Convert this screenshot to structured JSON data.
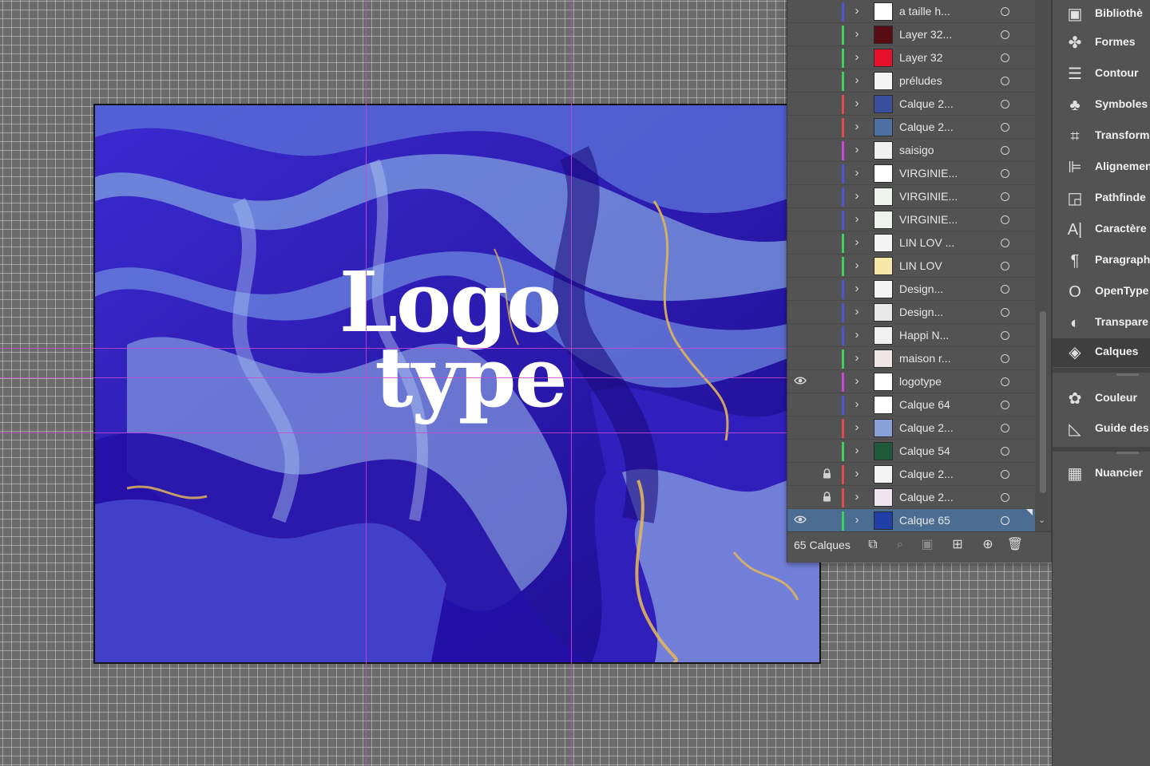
{
  "artboard": {
    "logotype_line1": "Logo",
    "logotype_line2": "type"
  },
  "layers_panel": {
    "layers": [
      {
        "name": "a taille h...",
        "color": "#4b55d6",
        "visible": false,
        "locked": false,
        "thumb": "#ffffff"
      },
      {
        "name": "Layer 32...",
        "color": "#3fd05b",
        "visible": false,
        "locked": false,
        "thumb": "#5a0c14"
      },
      {
        "name": "Layer 32",
        "color": "#3fd05b",
        "visible": false,
        "locked": false,
        "thumb": "#e8102b"
      },
      {
        "name": "préludes",
        "color": "#3fd05b",
        "visible": false,
        "locked": false,
        "thumb": "#f4f4f4"
      },
      {
        "name": "Calque 2...",
        "color": "#e34a4a",
        "visible": false,
        "locked": false,
        "thumb": "#3a4f9c"
      },
      {
        "name": "Calque 2...",
        "color": "#e34a4a",
        "visible": false,
        "locked": false,
        "thumb": "#4e6fa2"
      },
      {
        "name": "saisigo",
        "color": "#c64ad3",
        "visible": false,
        "locked": false,
        "thumb": "#f0f0f0"
      },
      {
        "name": "VIRGINIE...",
        "color": "#4b55d6",
        "visible": false,
        "locked": false,
        "thumb": "#ffffff"
      },
      {
        "name": "VIRGINIE...",
        "color": "#4b55d6",
        "visible": false,
        "locked": false,
        "thumb": "#eef3ee"
      },
      {
        "name": "VIRGINIE...",
        "color": "#4b55d6",
        "visible": false,
        "locked": false,
        "thumb": "#eef3ee"
      },
      {
        "name": "LIN LOV ...",
        "color": "#3fd05b",
        "visible": false,
        "locked": false,
        "thumb": "#f4f4f4"
      },
      {
        "name": "LIN LOV",
        "color": "#3fd05b",
        "visible": false,
        "locked": false,
        "thumb": "#f7e7a8"
      },
      {
        "name": "Design...",
        "color": "#4b55d6",
        "visible": false,
        "locked": false,
        "thumb": "#f4f4f4"
      },
      {
        "name": "Design...",
        "color": "#4b55d6",
        "visible": false,
        "locked": false,
        "thumb": "#e8e8e8"
      },
      {
        "name": "Happi N...",
        "color": "#4b55d6",
        "visible": false,
        "locked": false,
        "thumb": "#f1f1f1"
      },
      {
        "name": "maison r...",
        "color": "#3fd05b",
        "visible": false,
        "locked": false,
        "thumb": "#f1e6e6"
      },
      {
        "name": "logotype",
        "color": "#c64ad3",
        "visible": true,
        "locked": false,
        "thumb": "#ffffff"
      },
      {
        "name": "Calque 64",
        "color": "#4b55d6",
        "visible": false,
        "locked": false,
        "thumb": "#ffffff"
      },
      {
        "name": "Calque 2...",
        "color": "#e34a4a",
        "visible": false,
        "locked": false,
        "thumb": "#8aa0d8"
      },
      {
        "name": "Calque 54",
        "color": "#3fd05b",
        "visible": false,
        "locked": false,
        "thumb": "#1e5a3a"
      },
      {
        "name": "Calque 2...",
        "color": "#e34a4a",
        "visible": false,
        "locked": true,
        "thumb": "#f3f3f3"
      },
      {
        "name": "Calque 2...",
        "color": "#e34a4a",
        "visible": false,
        "locked": true,
        "thumb": "#efe4ef"
      },
      {
        "name": "Calque 65",
        "color": "#3fd05b",
        "visible": true,
        "locked": false,
        "thumb": "#1f3fa6",
        "selected": true
      }
    ],
    "count_label": "65 Calques"
  },
  "dock": {
    "items": [
      {
        "label": "Bibliothè",
        "icon": "libraries-icon",
        "glyph": "▣"
      },
      {
        "label": "Formes",
        "icon": "shapes-icon",
        "glyph": "✤"
      },
      {
        "label": "Contour",
        "icon": "stroke-icon",
        "glyph": "☰"
      },
      {
        "label": "Symboles",
        "icon": "symbols-icon",
        "glyph": "♣"
      },
      {
        "label": "Transform",
        "icon": "transform-icon",
        "glyph": "⌗"
      },
      {
        "label": "Alignemen",
        "icon": "align-icon",
        "glyph": "⊫"
      },
      {
        "label": "Pathfinde",
        "icon": "pathfinder-icon",
        "glyph": "◲"
      },
      {
        "label": "Caractère",
        "icon": "character-icon",
        "glyph": "A|"
      },
      {
        "label": "Paragraph",
        "icon": "paragraph-icon",
        "glyph": "¶"
      },
      {
        "label": "OpenType",
        "icon": "opentype-icon",
        "glyph": "O"
      },
      {
        "label": "Transpare",
        "icon": "transparency-icon",
        "glyph": "◐"
      },
      {
        "label": "Calques",
        "icon": "layers-icon",
        "glyph": "◈",
        "active": true
      },
      {
        "label": "Couleur",
        "icon": "color-icon",
        "glyph": "✿"
      },
      {
        "label": "Guide des",
        "icon": "color-guide-icon",
        "glyph": "◺"
      },
      {
        "label": "Nuancier",
        "icon": "swatches-icon",
        "glyph": "▦"
      }
    ]
  }
}
